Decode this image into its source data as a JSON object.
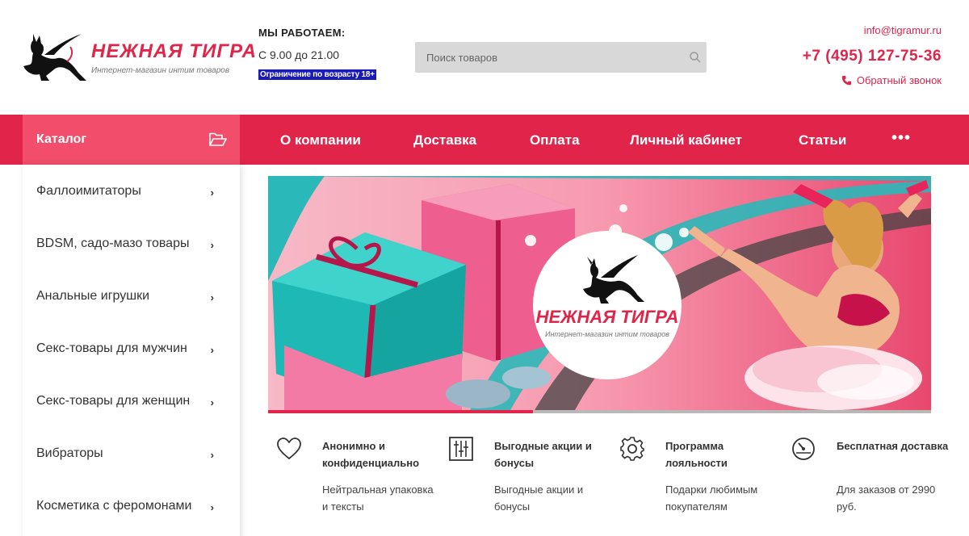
{
  "brand": {
    "name": "НЕЖНАЯ ТИГРА",
    "tagline": "Интернет-магазин интим товаров",
    "accent_color": "#e0244a"
  },
  "hours": {
    "title": "МЫ РАБОТАЕМ:",
    "time": "С 9.00 до 21.00",
    "age_notice": "Ограничение по возрасту 18+"
  },
  "search": {
    "placeholder": "Поиск товаров",
    "icon": "search-icon"
  },
  "contacts": {
    "email": "info@tigramur.ru",
    "phone": "+7 (495) 127-75-36",
    "callback_label": "Обратный звонок",
    "callback_icon": "phone-icon"
  },
  "nav": {
    "catalog_label": "Каталог",
    "catalog_icon": "folder-open-icon",
    "items": [
      "О компании",
      "Доставка",
      "Оплата",
      "Личный кабинет",
      "Статьи"
    ],
    "more_label": "•••"
  },
  "sidebar": {
    "items": [
      {
        "label": "Фаллоимитаторы"
      },
      {
        "label": "BDSM, садо-мазо товары"
      },
      {
        "label": "Анальные игрушки"
      },
      {
        "label": "Секс-товары для мужчин"
      },
      {
        "label": "Секс-товары для женщин"
      },
      {
        "label": "Вибраторы"
      },
      {
        "label": "Косметика с феромонами"
      }
    ],
    "arrow": "›"
  },
  "banner": {
    "logo_name": "НЕЖНАЯ ТИГРА",
    "logo_tagline": "Интернет-магазин интим товаров",
    "progress": 0.4
  },
  "features": [
    {
      "icon": "heart-icon",
      "title": "Анонимно и конфиденциально",
      "text": "Нейтральная упаковка и тексты"
    },
    {
      "icon": "sliders-icon",
      "title": "Выгодные акции и бонусы",
      "text": "Выгодные акции и бонусы"
    },
    {
      "icon": "gear-icon",
      "title": "Программа лояльности",
      "text": "Подарки любимым покупателям"
    },
    {
      "icon": "speedometer-icon",
      "title": "Бесплатная доставка",
      "text": "Для заказов от 2990 руб."
    }
  ]
}
